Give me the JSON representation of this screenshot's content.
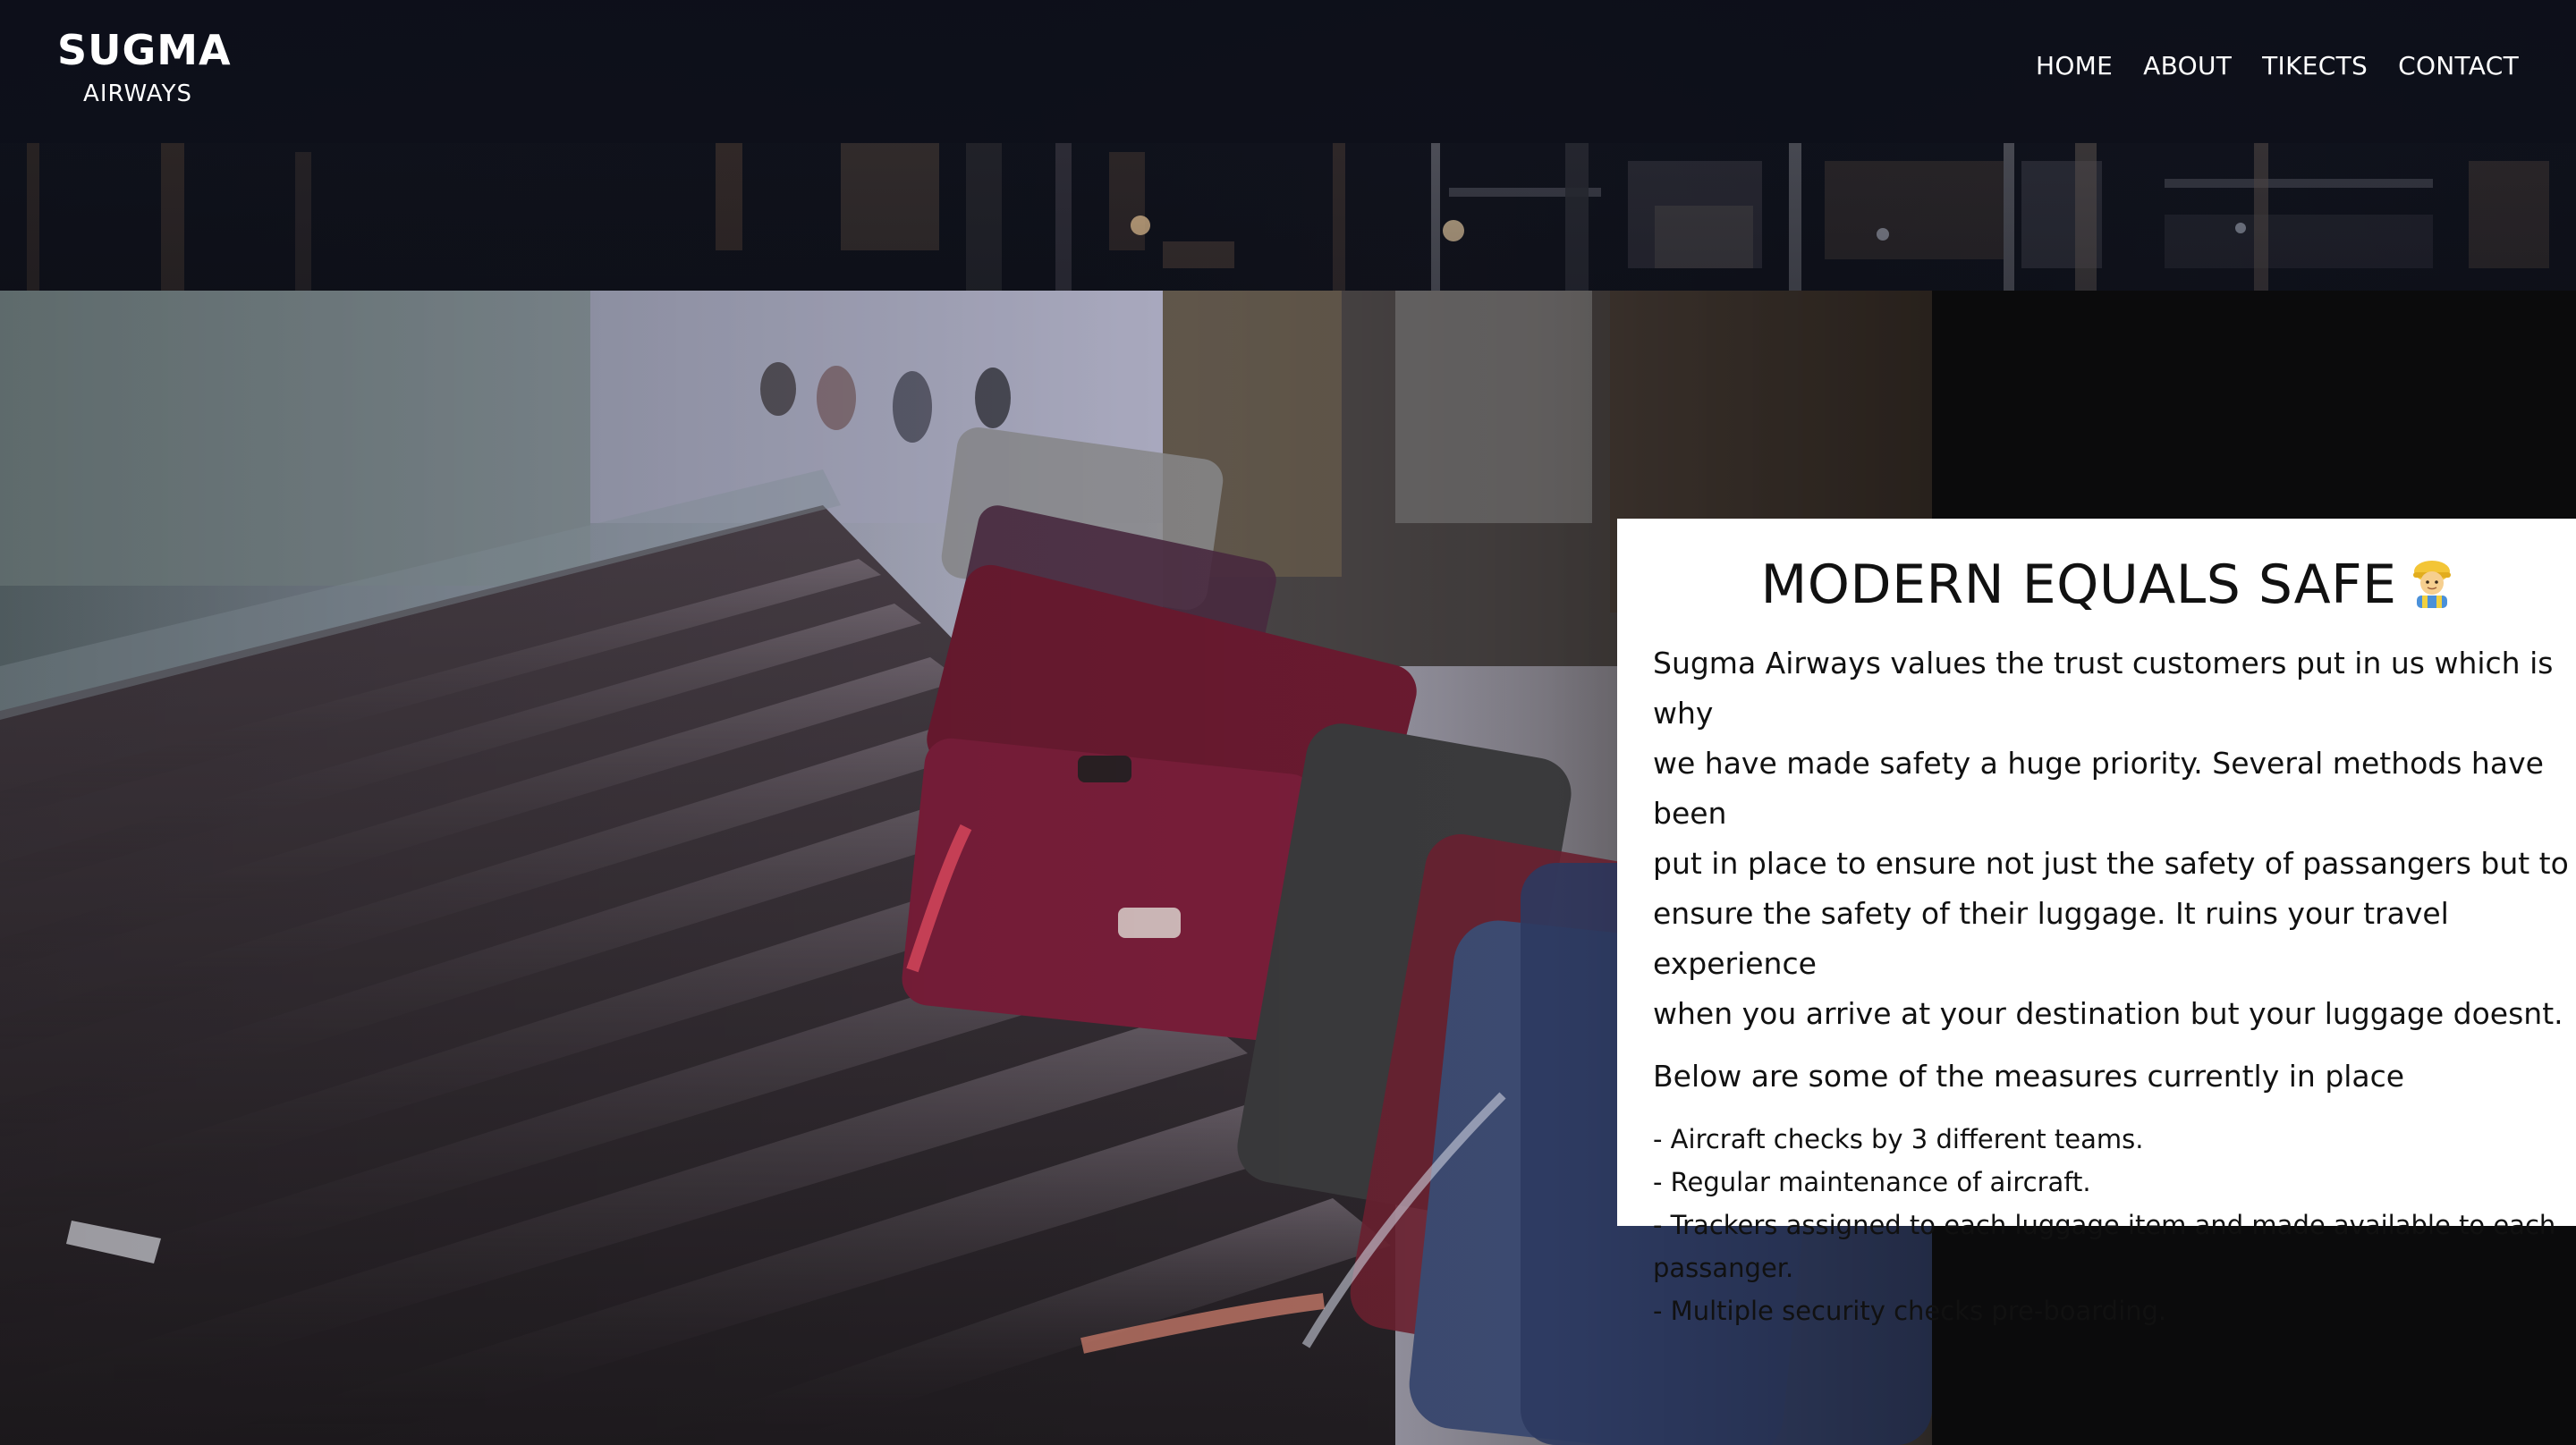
{
  "brand": {
    "name": "SUGMA",
    "subtitle": "AIRWAYS"
  },
  "nav": {
    "items": [
      {
        "label": "HOME"
      },
      {
        "label": "ABOUT"
      },
      {
        "label": "TIKECTS"
      },
      {
        "label": "CONTACT"
      }
    ]
  },
  "colors": {
    "header_bg": "#0d101a",
    "page_bg": "#0b0b0c",
    "card_bg": "#ffffff",
    "text_dark": "#111111",
    "text_light": "#ffffff"
  },
  "hero": {
    "image": "airport-baggage-carousel-photo"
  },
  "safety": {
    "title": "MODERN EQUALS SAFE",
    "title_icon": "construction-worker-emoji",
    "body": "Sugma Airways values the trust customers put in us which is why\nwe have made safety a huge priority. Several methods have been\nput in place to ensure not just the safety of passangers but to\nensure the safety of their luggage. It ruins your travel experience\nwhen you arrive at your destination but your luggage doesnt.",
    "intro": "Below are some of the measures currently in place",
    "measures": [
      "- Aircraft checks by 3 different teams.",
      "- Regular maintenance of aircraft.",
      "- Trackers assigned to each luggage item and made available to each",
      "passanger.",
      "- Multiple security checks pre-boarding."
    ]
  }
}
